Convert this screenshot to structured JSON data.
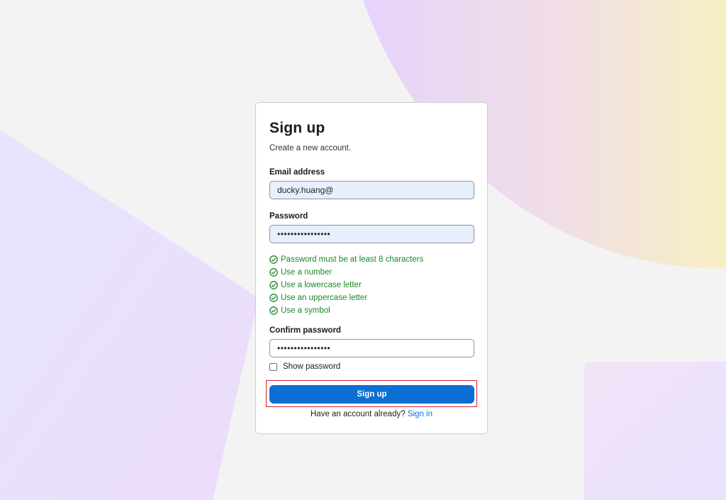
{
  "colors": {
    "page_background": "#f3f3f3",
    "accent": "#0b6fd4",
    "success": "#1a8a2a",
    "highlight_border": "#d0202e"
  },
  "form": {
    "title": "Sign up",
    "subtitle": "Create a new account.",
    "email": {
      "label": "Email address",
      "value": "ducky.huang@"
    },
    "password": {
      "label": "Password",
      "value": "••••••••••••••••"
    },
    "password_rules": [
      {
        "text": "Password must be at least 8 characters",
        "icon": "check-circle-icon",
        "met": true
      },
      {
        "text": "Use a number",
        "icon": "check-circle-icon",
        "met": true
      },
      {
        "text": "Use a lowercase letter",
        "icon": "check-circle-icon",
        "met": true
      },
      {
        "text": "Use an uppercase letter",
        "icon": "check-circle-icon",
        "met": true
      },
      {
        "text": "Use a symbol",
        "icon": "check-circle-icon",
        "met": true
      }
    ],
    "confirm_password": {
      "label": "Confirm password",
      "value": "••••••••••••••••"
    },
    "show_password": {
      "label": "Show password",
      "checked": false
    },
    "submit_label": "Sign up",
    "footer_text": "Have an account already?",
    "signin_link": "Sign in"
  }
}
